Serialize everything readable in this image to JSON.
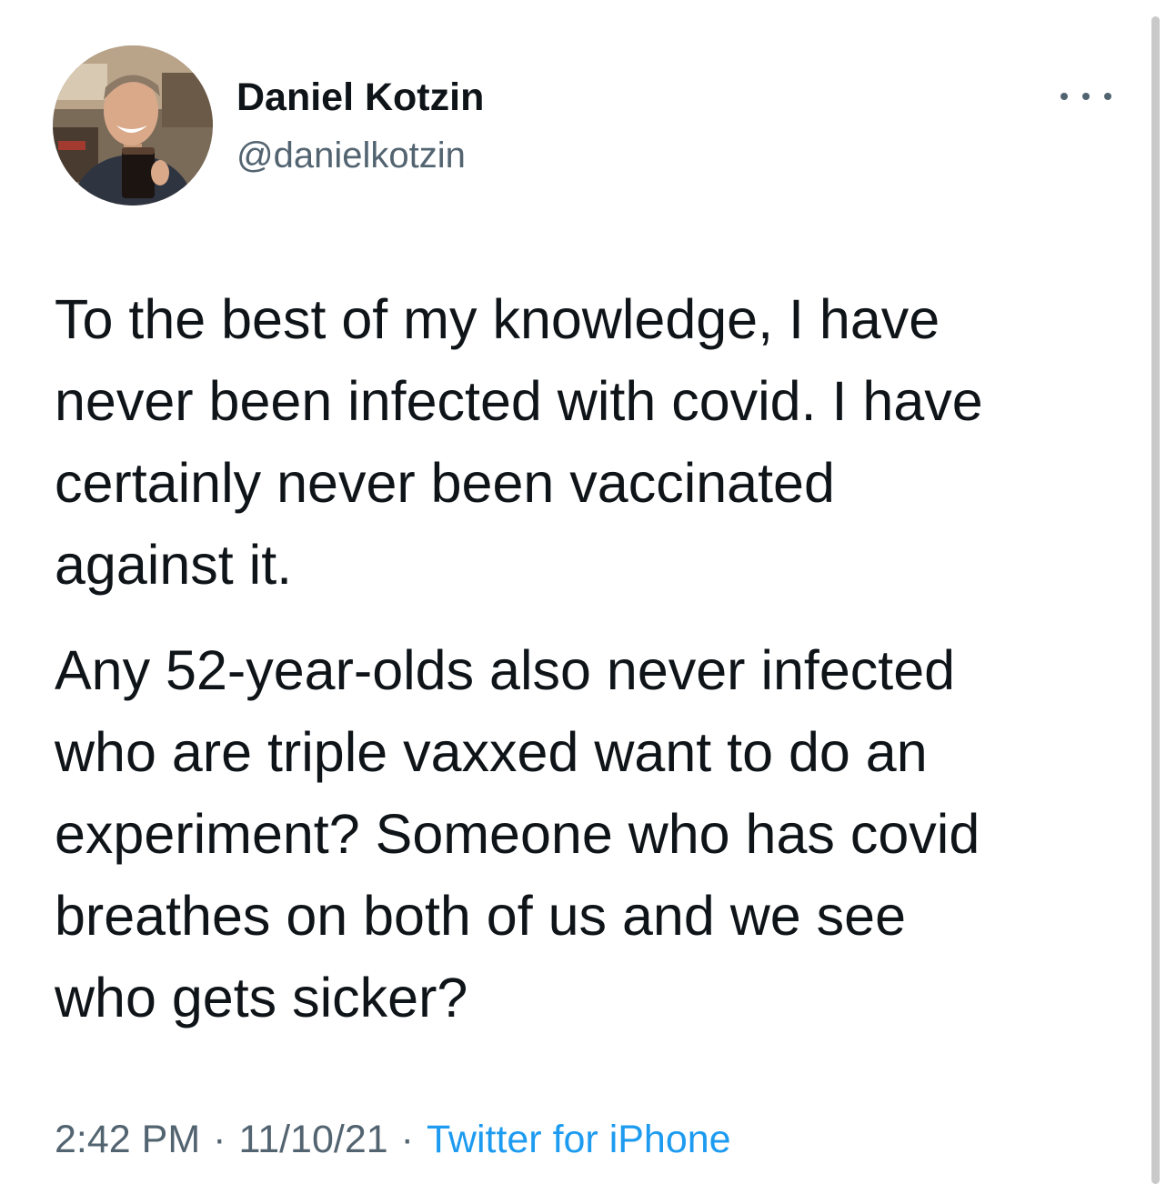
{
  "author": {
    "display_name": "Daniel Kotzin",
    "handle": "@danielkotzin",
    "avatar_icon": "profile-photo-avatar-icon"
  },
  "more_menu": {
    "icon": "more-horizontal-icon"
  },
  "tweet": {
    "paragraph_1": [
      "To the best of my knowledge, I have",
      "never been infected with covid. I have",
      "certainly never been vaccinated",
      "against it."
    ],
    "paragraph_2": [
      "Any 52-year-olds also never infected",
      "who are triple vaxxed want to do an",
      "experiment? Someone who has covid",
      "breathes on both of us and we see",
      "who gets sicker?"
    ]
  },
  "meta": {
    "time": "2:42 PM",
    "separator": "·",
    "date": "11/10/21",
    "source": "Twitter for iPhone"
  },
  "colors": {
    "text_primary": "#0f1419",
    "text_secondary": "#536471",
    "link": "#1d9bf0"
  }
}
